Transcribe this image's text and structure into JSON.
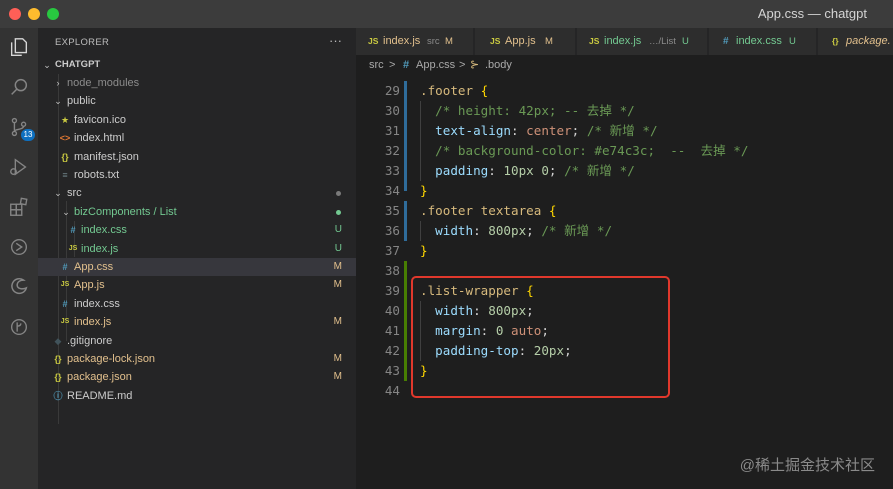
{
  "window": {
    "title": "App.css — chatgpt"
  },
  "activity_bar": {
    "scm_badge": "13"
  },
  "explorer": {
    "title": "EXPLORER",
    "more": "···",
    "root": "CHATGPT",
    "rows": [
      {
        "name": "node_modules",
        "icon": "",
        "status": "",
        "dim": true
      },
      {
        "name": "public",
        "icon": "",
        "status": ""
      },
      {
        "name": "favicon.ico",
        "icon": "★",
        "status": ""
      },
      {
        "name": "index.html",
        "icon": "<>",
        "status": ""
      },
      {
        "name": "manifest.json",
        "icon": "{}",
        "status": ""
      },
      {
        "name": "robots.txt",
        "icon": "≡",
        "status": ""
      },
      {
        "name": "src",
        "icon": "",
        "status": ""
      },
      {
        "name": "bizComponents / List",
        "icon": "",
        "status": ""
      },
      {
        "name": "index.css",
        "icon": "#",
        "status": "U"
      },
      {
        "name": "index.js",
        "icon": "JS",
        "status": "U"
      },
      {
        "name": "App.css",
        "icon": "#",
        "status": "M"
      },
      {
        "name": "App.js",
        "icon": "JS",
        "status": "M"
      },
      {
        "name": "index.css",
        "icon": "#",
        "status": ""
      },
      {
        "name": "index.js",
        "icon": "JS",
        "status": "M"
      },
      {
        "name": ".gitignore",
        "icon": "◆",
        "status": ""
      },
      {
        "name": "package-lock.json",
        "icon": "{}",
        "status": "M"
      },
      {
        "name": "package.json",
        "icon": "{}",
        "status": "M"
      },
      {
        "name": "README.md",
        "icon": "ⓘ",
        "status": ""
      }
    ]
  },
  "tabs": [
    {
      "icon": "JS",
      "name": "index.js",
      "desc": "src",
      "status": "M"
    },
    {
      "icon": "JS",
      "name": "App.js",
      "desc": "",
      "status": "M"
    },
    {
      "icon": "JS",
      "name": "index.js",
      "desc": "…/List",
      "status": "U"
    },
    {
      "icon": "#",
      "name": "index.css",
      "desc": "",
      "status": "U"
    },
    {
      "icon": "{}",
      "name": "package.",
      "desc": "",
      "status": ""
    }
  ],
  "breadcrumb": {
    "folder": "src",
    "sep": ">",
    "file_icon": "#",
    "file": "App.css",
    "symbol_icon": "⊱",
    "symbol": ".body"
  },
  "code": {
    "lines": [
      {
        "n": "29",
        "tokens": [
          [
            "sel",
            ".footer "
          ],
          [
            "brace",
            "{"
          ]
        ]
      },
      {
        "n": "30",
        "tokens": [
          [
            "comment",
            "  /* height: 42px; -- 去掉 */"
          ]
        ]
      },
      {
        "n": "31",
        "tokens": [
          [
            "prop",
            "  text-align"
          ],
          [
            "punct",
            ": "
          ],
          [
            "val",
            "center"
          ],
          [
            "punct",
            "; "
          ],
          [
            "comment",
            "/* 新增 */"
          ]
        ]
      },
      {
        "n": "32",
        "tokens": [
          [
            "comment",
            "  /* background-color: #e74c3c;  --  去掉 */"
          ]
        ]
      },
      {
        "n": "33",
        "tokens": [
          [
            "prop",
            "  padding"
          ],
          [
            "punct",
            ": "
          ],
          [
            "num",
            "10px 0"
          ],
          [
            "punct",
            "; "
          ],
          [
            "comment",
            "/* 新增 */"
          ]
        ]
      },
      {
        "n": "34",
        "tokens": [
          [
            "brace",
            "}"
          ]
        ]
      },
      {
        "n": "35",
        "tokens": [
          [
            "sel",
            ".footer textarea "
          ],
          [
            "brace",
            "{"
          ]
        ]
      },
      {
        "n": "36",
        "tokens": [
          [
            "prop",
            "  width"
          ],
          [
            "punct",
            ": "
          ],
          [
            "num",
            "800px"
          ],
          [
            "punct",
            "; "
          ],
          [
            "comment",
            "/* 新增 */"
          ]
        ]
      },
      {
        "n": "37",
        "tokens": [
          [
            "brace",
            "}"
          ]
        ]
      },
      {
        "n": "38",
        "tokens": []
      },
      {
        "n": "39",
        "tokens": [
          [
            "sel",
            ".list-wrapper "
          ],
          [
            "brace",
            "{"
          ]
        ]
      },
      {
        "n": "40",
        "tokens": [
          [
            "prop",
            "  width"
          ],
          [
            "punct",
            ": "
          ],
          [
            "num",
            "800px"
          ],
          [
            "punct",
            ";"
          ]
        ]
      },
      {
        "n": "41",
        "tokens": [
          [
            "prop",
            "  margin"
          ],
          [
            "punct",
            ": "
          ],
          [
            "num",
            "0"
          ],
          [
            "punct",
            " "
          ],
          [
            "val",
            "auto"
          ],
          [
            "punct",
            ";"
          ]
        ]
      },
      {
        "n": "42",
        "tokens": [
          [
            "prop",
            "  padding-top"
          ],
          [
            "punct",
            ": "
          ],
          [
            "num",
            "20px"
          ],
          [
            "punct",
            ";"
          ]
        ]
      },
      {
        "n": "43",
        "tokens": [
          [
            "brace",
            "}"
          ]
        ]
      },
      {
        "n": "44",
        "tokens": []
      }
    ]
  },
  "watermark": "@稀土掘金技术社区",
  "colors": {
    "modified": "#e2c08d",
    "untracked": "#73c991",
    "js": "#cbcb41",
    "css": "#519aba",
    "json": "#cbcb41",
    "highlight": "#e0382c"
  }
}
